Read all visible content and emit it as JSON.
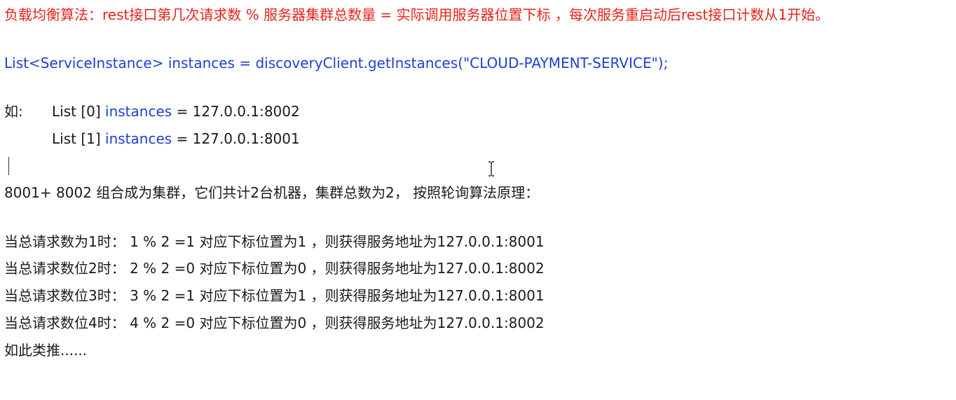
{
  "heading": {
    "text": "负载均衡算法：rest接口第几次请求数 % 服务器集群总数量 = 实际调用服务器位置下标 ，每次服务重启动后rest接口计数从1开始。",
    "color": "#e8231b"
  },
  "code": {
    "type": "List<ServiceInstance>",
    "varname": "instances",
    "eq": "=",
    "call": "discoveryClient.getInstances(\"CLOUD-PAYMENT-SERVICE\");",
    "color": "#1f3fd1"
  },
  "example": {
    "prefix": "如:",
    "rows": [
      {
        "list": "List [0]",
        "name": "instances",
        "eq": "=",
        "value": "127.0.0.1:8002"
      },
      {
        "list": "List [1]",
        "name": "instances",
        "eq": "=",
        "value": "127.0.0.1:8001"
      }
    ]
  },
  "cluster_line": "8001+ 8002 组合成为集群，它们共计2台机器，集群总数为2， 按照轮询算法原理：",
  "requests": [
    "当总请求数为1时： 1 % 2 =1 对应下标位置为1 ，则获得服务地址为127.0.0.1:8001",
    "当总请求数位2时： 2 % 2 =0 对应下标位置为0 ，则获得服务地址为127.0.0.1:8002",
    "当总请求数位3时： 3 % 2 =1 对应下标位置为1 ，则获得服务地址为127.0.0.1:8001",
    "当总请求数位4时： 4 % 2 =0 对应下标位置为0 ，则获得服务地址为127.0.0.1:8002"
  ],
  "footer": "如此类推......"
}
